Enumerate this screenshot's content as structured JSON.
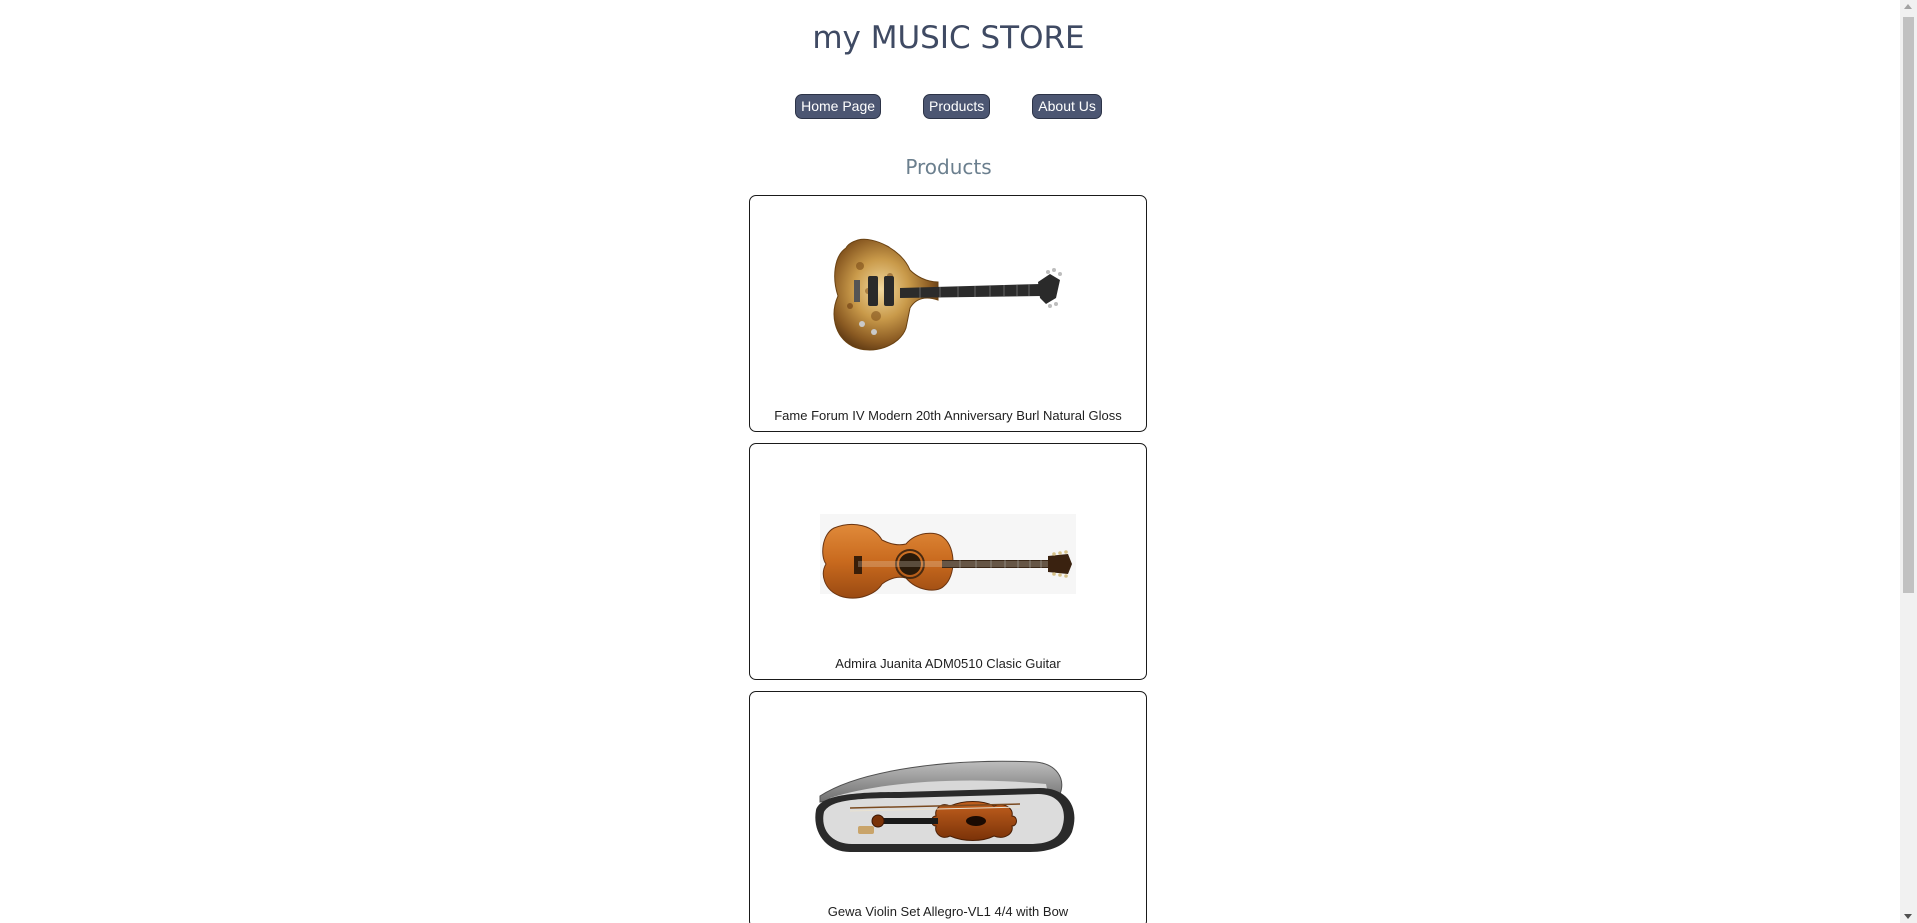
{
  "header": {
    "title": "my MUSIC STORE"
  },
  "nav": {
    "items": [
      {
        "label": "Home Page"
      },
      {
        "label": "Products"
      },
      {
        "label": "About Us"
      }
    ]
  },
  "main": {
    "section_title": "Products",
    "products": [
      {
        "name": "Fame Forum IV Modern 20th Anniversary Burl Natural Gloss",
        "image": "electric-guitar-image"
      },
      {
        "name": "Admira Juanita ADM0510 Clasic Guitar",
        "image": "classical-guitar-image"
      },
      {
        "name": "Gewa Violin Set Allegro-VL1 4/4 with Bow",
        "image": "violin-case-image"
      }
    ]
  },
  "colors": {
    "title": "#3f4a63",
    "nav_button_bg": "#4c5672",
    "section_title": "#6b7f8e"
  }
}
